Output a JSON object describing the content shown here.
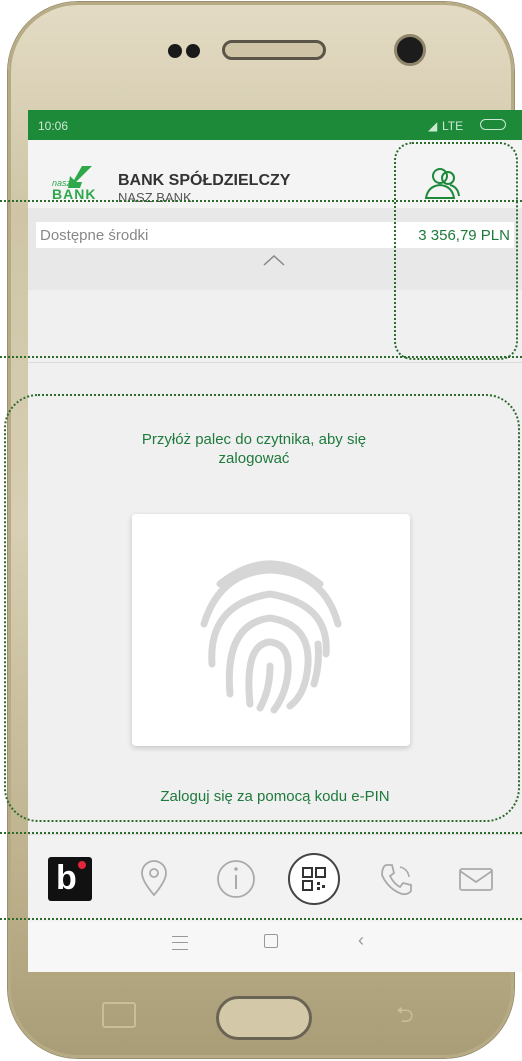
{
  "status_bar": {
    "time": "10:06",
    "signal": "LTE"
  },
  "header": {
    "logo_small": "nasz",
    "logo_big": "BANK",
    "bank_name": "BANK SPÓŁDZIELCZY",
    "bank_sub": "NASZ BANK",
    "profile_icon": "users-icon"
  },
  "balance": {
    "label": "Dostępne środki",
    "value": "3 356,79 PLN"
  },
  "login": {
    "instruction": "Przyłóż palec do czytnika, aby się zalogować",
    "epin_link": "Zaloguj się za pomocą kodu e-PIN"
  },
  "tabbar": {
    "items": [
      {
        "icon": "blik-icon",
        "name": "blik"
      },
      {
        "icon": "location-pin-icon",
        "name": "location"
      },
      {
        "icon": "info-icon",
        "name": "info"
      },
      {
        "icon": "qr-code-icon",
        "name": "qr"
      },
      {
        "icon": "phone-icon",
        "name": "phone"
      },
      {
        "icon": "mail-icon",
        "name": "mail"
      }
    ]
  },
  "colors": {
    "brand_green": "#1d8a3a",
    "text_green": "#1f7a3d",
    "dotted_border": "#2b6b2b"
  }
}
